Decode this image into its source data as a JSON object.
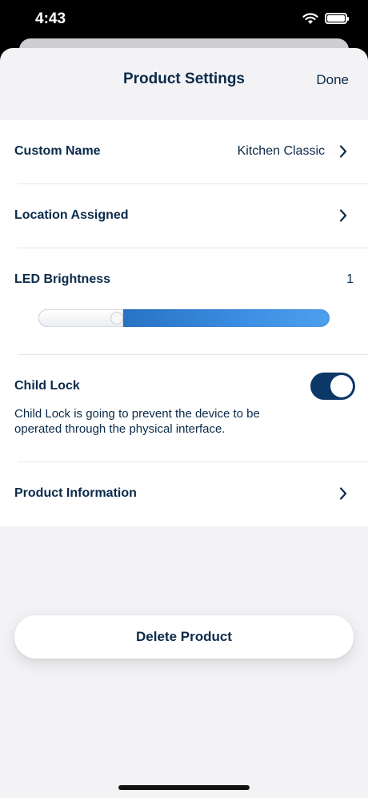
{
  "status_bar": {
    "time": "4:43"
  },
  "nav": {
    "title": "Product Settings",
    "done_label": "Done"
  },
  "rows": {
    "custom_name": {
      "label": "Custom Name",
      "value": "Kitchen Classic"
    },
    "location": {
      "label": "Location Assigned"
    },
    "led": {
      "label": "LED Brightness",
      "value": "1"
    },
    "child_lock": {
      "label": "Child Lock",
      "enabled": true,
      "description": "Child Lock is going to prevent the device to be operated through the physical interface."
    },
    "product_info": {
      "label": "Product Information"
    }
  },
  "delete_label": "Delete Product",
  "colors": {
    "primary": "#0b2a4a",
    "toggle_on": "#0b3866",
    "slider": "#3b8ee2"
  }
}
